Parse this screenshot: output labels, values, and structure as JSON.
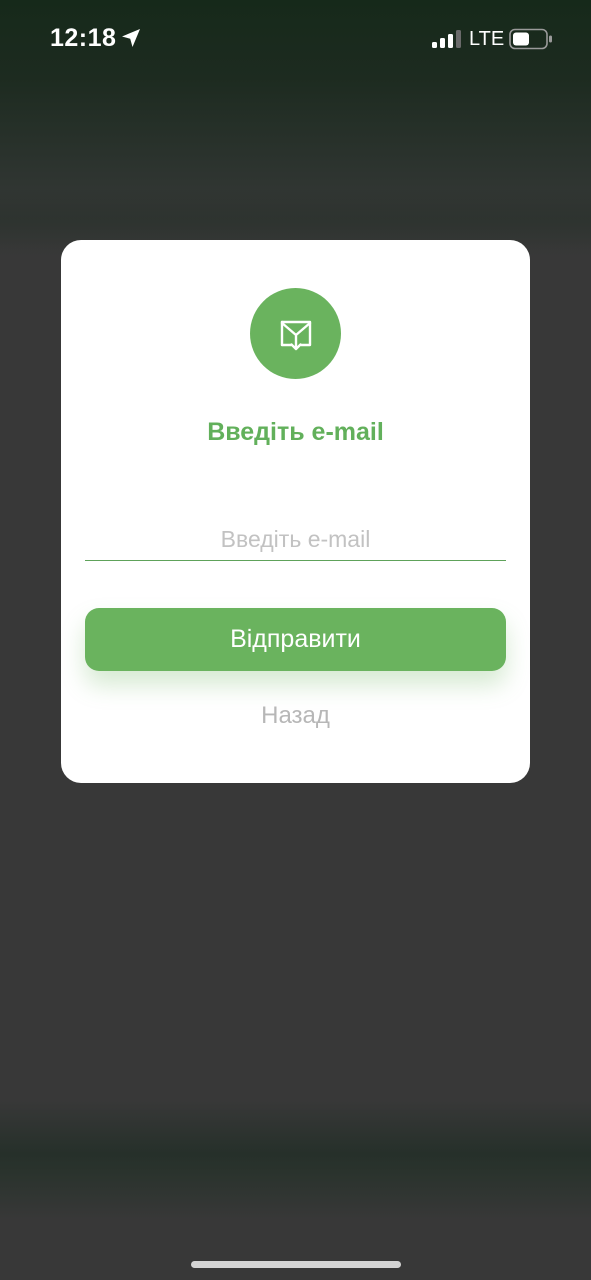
{
  "status_bar": {
    "time": "12:18",
    "network": "LTE",
    "icons": [
      "location-arrow-icon",
      "cellular-signal-icon",
      "battery-icon"
    ]
  },
  "dialog": {
    "icon": "mail-download-icon",
    "title": "Введіть e-mail",
    "email_input": {
      "value": "",
      "placeholder": "Введіть e-mail"
    },
    "submit_label": "Відправити",
    "back_label": "Назад"
  },
  "colors": {
    "accent": "#6ab35e",
    "title": "#62b05b",
    "back_text": "#b7b7b7",
    "overlay": "#383838"
  }
}
